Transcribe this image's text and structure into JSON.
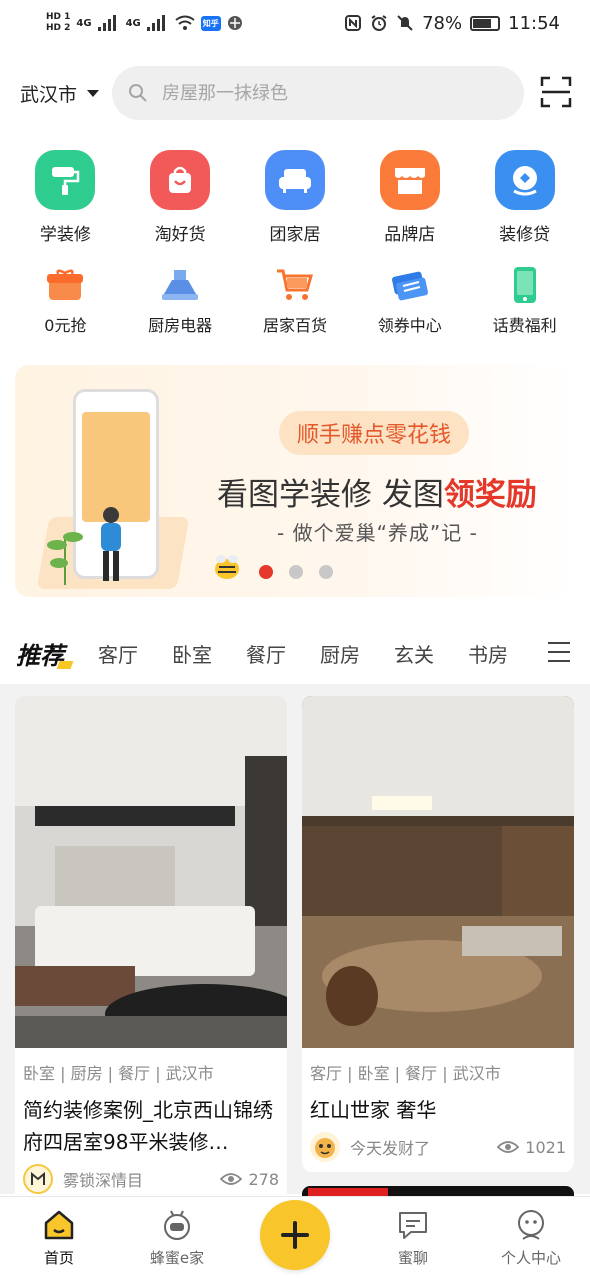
{
  "status_bar": {
    "hd1": "HD 1",
    "hd2": "HD 2",
    "sig1": "4G",
    "sig2": "4G",
    "zhihu": "知乎",
    "battery": "78%",
    "time": "11:54"
  },
  "header": {
    "city": "武汉市",
    "search_placeholder": "房屋那一抹绿色"
  },
  "primary_entries": [
    {
      "label": "学装修",
      "color": "#2ecc8f"
    },
    {
      "label": "淘好货",
      "color": "#f25a5a"
    },
    {
      "label": "团家居",
      "color": "#4d8ef7"
    },
    {
      "label": "品牌店",
      "color": "#fb7b3b"
    },
    {
      "label": "装修贷",
      "color": "#3a8ff0"
    }
  ],
  "secondary_entries": [
    {
      "label": "0元抢"
    },
    {
      "label": "厨房电器"
    },
    {
      "label": "居家百货"
    },
    {
      "label": "领券中心"
    },
    {
      "label": "话费福利"
    }
  ],
  "banner": {
    "pill": "顺手赚点零花钱",
    "headline_a": "看图学装修 发图",
    "headline_b": "领奖励",
    "subline": "- 做个爱巢“养成”记 -",
    "active_dot": 0
  },
  "tabs": {
    "recommended": "推荐",
    "items": [
      "客厅",
      "卧室",
      "餐厅",
      "厨房",
      "玄关",
      "书房"
    ]
  },
  "feed": [
    {
      "tags": "卧室 | 厨房 | 餐厅 | 武汉市",
      "title": "简约装修案例_北京西山锦绣府四居室98平米装修…",
      "author": "雾锁深情目",
      "views": "278"
    },
    {
      "tags": "客厅 | 卧室 | 餐厅 | 武汉市",
      "title": "红山世家 奢华",
      "author": "今天发财了",
      "views": "1021"
    }
  ],
  "bottom_nav": {
    "home": "首页",
    "bee": "蜂蜜e家",
    "chat": "蜜聊",
    "me": "个人中心"
  },
  "colors": {
    "accent": "#f8c52a",
    "red": "#e4382b"
  }
}
